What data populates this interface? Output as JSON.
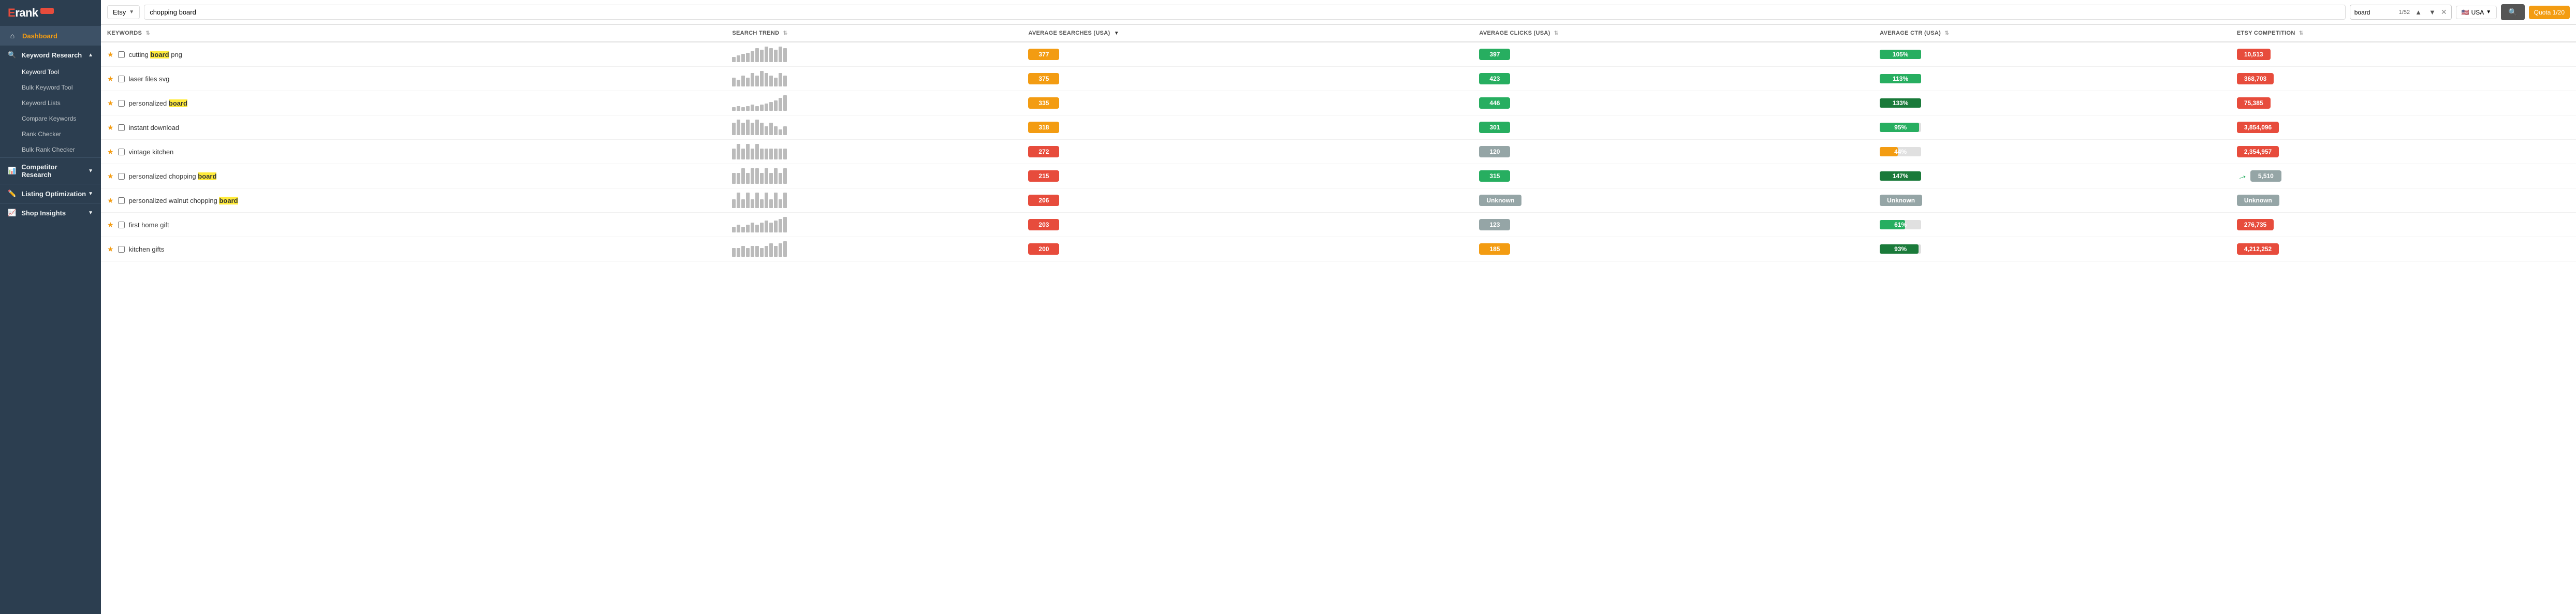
{
  "sidebar": {
    "logo": "Erank",
    "pro": "PRO",
    "nav": [
      {
        "id": "dashboard",
        "label": "Dashboard",
        "icon": "⌂",
        "active": true,
        "highlight": true
      },
      {
        "id": "keyword-research",
        "label": "Keyword Research",
        "icon": "🔍",
        "expanded": true
      },
      {
        "id": "competitor-research",
        "label": "Competitor Research",
        "icon": "📊",
        "expanded": true
      },
      {
        "id": "listing-optimization",
        "label": "Listing Optimization",
        "icon": "✏️",
        "expanded": false
      },
      {
        "id": "shop-insights",
        "label": "Shop Insights",
        "icon": "📈",
        "expanded": false
      }
    ],
    "keyword_sub": [
      {
        "id": "keyword-tool",
        "label": "Keyword Tool",
        "active": true
      },
      {
        "id": "bulk-keyword",
        "label": "Bulk Keyword Tool"
      },
      {
        "id": "keyword-lists",
        "label": "Keyword Lists"
      },
      {
        "id": "compare-keywords",
        "label": "Compare Keywords"
      },
      {
        "id": "rank-checker",
        "label": "Rank Checker"
      },
      {
        "id": "bulk-rank-checker",
        "label": "Bulk Rank Checker"
      }
    ]
  },
  "topbar": {
    "platform": "Etsy",
    "search_value": "chopping board",
    "search_highlight": "board",
    "find_value": "board",
    "find_count": "1/52",
    "country": "USA",
    "quota_label": "Quota 1/20"
  },
  "table": {
    "columns": [
      {
        "id": "keywords",
        "label": "KEYWORDS",
        "sort": true
      },
      {
        "id": "search-trend",
        "label": "SEARCH TREND",
        "sort": true
      },
      {
        "id": "avg-searches",
        "label": "AVERAGE SEARCHES (USA)",
        "sort": true,
        "sorted": true
      },
      {
        "id": "avg-clicks",
        "label": "AVERAGE CLICKS (USA)",
        "sort": true
      },
      {
        "id": "avg-ctr",
        "label": "AVERAGE CTR (USA)",
        "sort": true
      },
      {
        "id": "etsy-competition",
        "label": "ETSY COMPETITION",
        "sort": true
      }
    ],
    "rows": [
      {
        "id": 1,
        "keyword": "cutting board png",
        "highlight": "board",
        "highlight_word": "board",
        "starred": true,
        "trend": [
          2,
          3,
          4,
          5,
          6,
          8,
          7,
          9,
          8,
          7,
          9,
          8
        ],
        "searches": 377,
        "searches_color": "orange",
        "clicks": 397,
        "clicks_color": "green",
        "ctr": "105%",
        "ctr_pct": 100,
        "ctr_color": "#27ae60",
        "competition": 10513,
        "competition_color": "red",
        "arrow": false
      },
      {
        "id": 2,
        "keyword": "laser files svg",
        "highlight": "",
        "starred": true,
        "trend": [
          3,
          2,
          4,
          3,
          5,
          4,
          6,
          5,
          4,
          3,
          5,
          4
        ],
        "searches": 375,
        "searches_color": "orange",
        "clicks": 423,
        "clicks_color": "green",
        "ctr": "113%",
        "ctr_pct": 100,
        "ctr_color": "#27ae60",
        "competition": 368703,
        "competition_color": "red",
        "arrow": false
      },
      {
        "id": 3,
        "keyword": "personalized board",
        "highlight": "board",
        "starred": true,
        "trend": [
          1,
          2,
          1,
          2,
          3,
          2,
          3,
          4,
          5,
          6,
          8,
          10
        ],
        "searches": 335,
        "searches_color": "orange",
        "clicks": 446,
        "clicks_color": "green",
        "ctr": "133%",
        "ctr_pct": 100,
        "ctr_color": "#1a7a3a",
        "competition": 75385,
        "competition_color": "red",
        "arrow": false
      },
      {
        "id": 4,
        "keyword": "instant download",
        "highlight": "",
        "starred": true,
        "trend": [
          3,
          4,
          3,
          4,
          3,
          4,
          3,
          2,
          3,
          2,
          1,
          2
        ],
        "searches": 318,
        "searches_color": "orange",
        "clicks": 301,
        "clicks_color": "green",
        "ctr": "95%",
        "ctr_pct": 95,
        "ctr_color": "#27ae60",
        "competition": 3854096,
        "competition_color": "red",
        "arrow": false
      },
      {
        "id": 5,
        "keyword": "vintage kitchen",
        "highlight": "",
        "starred": true,
        "trend": [
          2,
          3,
          2,
          3,
          2,
          3,
          2,
          2,
          2,
          2,
          2,
          2
        ],
        "searches": 272,
        "searches_color": "red",
        "clicks": 120,
        "clicks_color": "gray",
        "ctr": "44%",
        "ctr_pct": 44,
        "ctr_color": "#f39c12",
        "competition": 2354957,
        "competition_color": "red",
        "arrow": false
      },
      {
        "id": 6,
        "keyword": "personalized chopping board",
        "highlight": "board",
        "starred": true,
        "trend": [
          2,
          2,
          3,
          2,
          3,
          3,
          2,
          3,
          2,
          3,
          2,
          3
        ],
        "searches": 215,
        "searches_color": "red",
        "clicks": 315,
        "clicks_color": "green",
        "ctr": "147%",
        "ctr_pct": 100,
        "ctr_color": "#1a7a3a",
        "competition": 5510,
        "competition_color": "gray",
        "arrow": true
      },
      {
        "id": 7,
        "keyword": "personalized walnut chopping board",
        "highlight": "board",
        "starred": true,
        "trend": [
          1,
          2,
          1,
          2,
          1,
          2,
          1,
          2,
          1,
          2,
          1,
          2
        ],
        "searches": 206,
        "searches_color": "red",
        "clicks_unknown": true,
        "ctr_unknown": true,
        "competition_unknown": true,
        "arrow": false
      },
      {
        "id": 8,
        "keyword": "first home gift",
        "highlight": "",
        "starred": true,
        "trend": [
          2,
          3,
          2,
          3,
          4,
          3,
          4,
          5,
          4,
          5,
          6,
          7
        ],
        "searches": 203,
        "searches_color": "red",
        "clicks": 123,
        "clicks_color": "gray",
        "ctr": "61%",
        "ctr_pct": 61,
        "ctr_color": "#27ae60",
        "competition": 276735,
        "competition_color": "red",
        "arrow": false
      },
      {
        "id": 9,
        "keyword": "kitchen gifts",
        "highlight": "",
        "starred": true,
        "trend": [
          3,
          3,
          4,
          3,
          4,
          4,
          3,
          4,
          5,
          4,
          5,
          6
        ],
        "searches": 200,
        "searches_color": "red",
        "clicks": 185,
        "clicks_color": "orange",
        "ctr": "93%",
        "ctr_pct": 93,
        "ctr_color": "#1a7a3a",
        "competition": 4212252,
        "competition_color": "red",
        "arrow": false
      }
    ]
  }
}
